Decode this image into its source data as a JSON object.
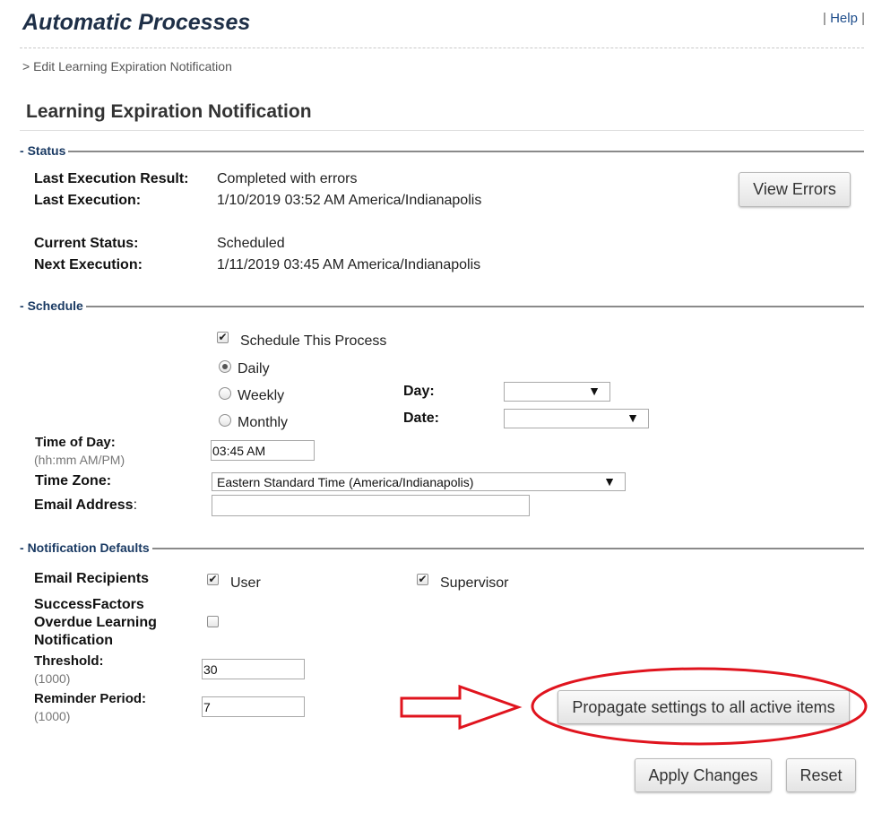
{
  "header": {
    "app_title": "Automatic Processes",
    "help_sep_left": "|",
    "help_label": "Help",
    "help_sep_right": "|",
    "breadcrumb": "> Edit Learning Expiration Notification"
  },
  "page_title": "Learning Expiration Notification",
  "status": {
    "section_label": "Status",
    "last_result_label": "Last Execution Result:",
    "last_result_value": "Completed with errors",
    "last_exec_label": "Last Execution:",
    "last_exec_value": "1/10/2019 03:52 AM America/Indianapolis",
    "current_status_label": "Current Status:",
    "current_status_value": "Scheduled",
    "next_exec_label": "Next Execution:",
    "next_exec_value": "1/11/2019 03:45 AM America/Indianapolis",
    "view_errors_button": "View Errors"
  },
  "schedule": {
    "section_label": "Schedule",
    "schedule_checkbox_label": "Schedule This Process",
    "schedule_checked": true,
    "frequency_options": [
      "Daily",
      "Weekly",
      "Monthly"
    ],
    "frequency_selected": "Daily",
    "day_label": "Day:",
    "day_value": "",
    "date_label": "Date:",
    "date_value": "",
    "time_label": "Time of Day:",
    "time_hint": "(hh:mm AM/PM)",
    "time_value": "03:45 AM",
    "timezone_label": "Time Zone:",
    "timezone_value": "Eastern Standard Time (America/Indianapolis)",
    "email_label": "Email Address",
    "email_colon": ":",
    "email_value": ""
  },
  "notification": {
    "section_label": "Notification Defaults",
    "recipients_label": "Email Recipients",
    "user_label": "User",
    "user_checked": true,
    "supervisor_label": "Supervisor",
    "supervisor_checked": true,
    "overdue_label_1": "SuccessFactors",
    "overdue_label_2": "Overdue Learning",
    "overdue_label_3": "Notification",
    "overdue_checked": false,
    "threshold_label": "Threshold:",
    "threshold_hint": "(1000)",
    "threshold_value": "30",
    "reminder_label": "Reminder Period:",
    "reminder_hint": "(1000)",
    "reminder_value": "7",
    "propagate_button": "Propagate settings to all active items"
  },
  "footer": {
    "apply_button": "Apply Changes",
    "reset_button": "Reset"
  },
  "icons": {
    "checkmark": "✔",
    "dropdown_arrow": "▼"
  },
  "colors": {
    "annotation_red": "#e0141e",
    "section_label_blue": "#1a3a63",
    "title_navy": "#1e2f47"
  }
}
